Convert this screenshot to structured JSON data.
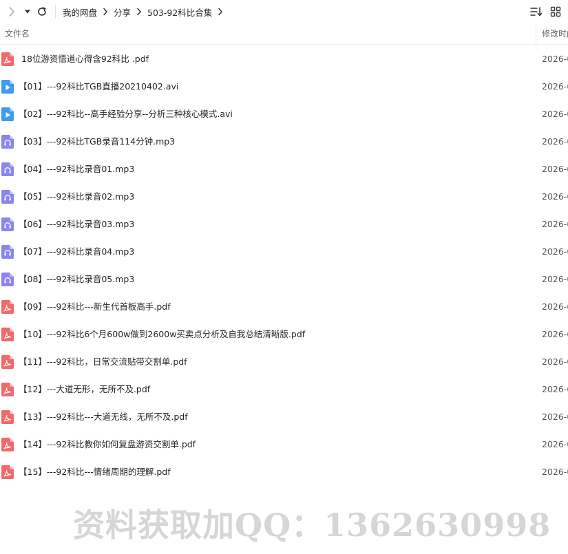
{
  "breadcrumb": [
    "我的网盘",
    "分享",
    "503-92科比合集"
  ],
  "columns": {
    "name": "文件名",
    "mtime": "修改时间"
  },
  "files": [
    {
      "type": "pdf",
      "name": "18位游资悟道心得含92科比  .pdf",
      "date": "2026-0"
    },
    {
      "type": "video",
      "name": "【01】---92科比TGB直播20210402.avi",
      "date": "2026-0"
    },
    {
      "type": "video",
      "name": "【02】---92科比--高手经验分享--分析三种核心模式.avi",
      "date": "2026-0"
    },
    {
      "type": "audio",
      "name": "【03】---92科比TGB录音114分钟.mp3",
      "date": "2026-0"
    },
    {
      "type": "audio",
      "name": "【04】---92科比录音01.mp3",
      "date": "2026-0"
    },
    {
      "type": "audio",
      "name": "【05】---92科比录音02.mp3",
      "date": "2026-0"
    },
    {
      "type": "audio",
      "name": "【06】---92科比录音03.mp3",
      "date": "2026-0"
    },
    {
      "type": "audio",
      "name": "【07】---92科比录音04.mp3",
      "date": "2026-0"
    },
    {
      "type": "audio",
      "name": "【08】---92科比录音05.mp3",
      "date": "2026-0"
    },
    {
      "type": "pdf",
      "name": "【09】---92科比---新生代首板高手.pdf",
      "date": "2026-0"
    },
    {
      "type": "pdf",
      "name": "【10】---92科比6个月600w做到2600w买卖点分析及自我总结清晰版.pdf",
      "date": "2026-0"
    },
    {
      "type": "pdf",
      "name": "【11】---92科比，日常交流贴带交割单.pdf",
      "date": "2026-0"
    },
    {
      "type": "pdf",
      "name": "【12】---大道无形，无所不及.pdf",
      "date": "2026-0"
    },
    {
      "type": "pdf",
      "name": "【13】---92科比---大道无线，无所不及.pdf",
      "date": "2026-0"
    },
    {
      "type": "pdf",
      "name": "【14】---92科比教你如何复盘游资交割单.pdf",
      "date": "2026-0"
    },
    {
      "type": "pdf",
      "name": "【15】---92科比---情绪周期的理解.pdf",
      "date": "2026-0"
    }
  ],
  "watermark": "资料获取加QQ：1362630998",
  "colors": {
    "pdf": "#f06a6a",
    "video": "#3e9bf2",
    "audio": "#8b85f0",
    "text": "#262626",
    "muted": "#666666"
  },
  "icons": {
    "forward": "chevron-right-icon",
    "dropdown": "caret-down-icon",
    "refresh": "refresh-icon",
    "sort": "sort-icon",
    "grid": "grid-view-icon",
    "pdf": "pdf-file-icon",
    "video": "video-file-icon",
    "audio": "audio-file-icon"
  }
}
